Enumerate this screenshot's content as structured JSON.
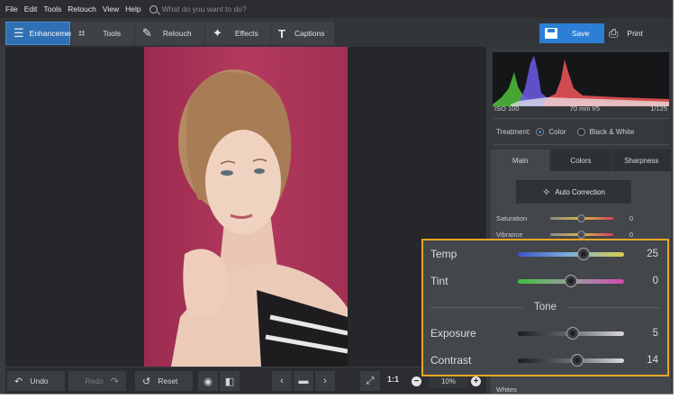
{
  "menu": {
    "items": [
      "File",
      "Edit",
      "Tools",
      "Retouch",
      "View",
      "Help"
    ],
    "search_placeholder": "What do you want to do?"
  },
  "toolbar": {
    "tabs": [
      {
        "label": "Enhancement",
        "icon": "sliders-icon",
        "active": true
      },
      {
        "label": "Tools",
        "icon": "crop-icon",
        "active": false
      },
      {
        "label": "Retouch",
        "icon": "brush-icon",
        "active": false
      },
      {
        "label": "Effects",
        "icon": "magic-wand-icon",
        "active": false
      },
      {
        "label": "Captions",
        "icon": "text-icon",
        "active": false
      }
    ],
    "save_label": "Save",
    "print_label": "Print"
  },
  "bottom": {
    "undo_label": "Undo",
    "redo_label": "Redo",
    "reset_label": "Reset",
    "zoom_ratio": "1:1",
    "zoom_value": "10%"
  },
  "panel": {
    "histogram": {
      "iso": "ISO 100",
      "lens": "70 mm f/5",
      "shutter": "1/125"
    },
    "treatment_label": "Treatment:",
    "treatment_options": [
      "Color",
      "Black & White"
    ],
    "treatment_selected": "Color",
    "subtabs": [
      "Main",
      "Colors",
      "Sharpness"
    ],
    "active_subtab": "Main",
    "auto_correction_label": "Auto Correction",
    "sliders": [
      {
        "label": "Saturation",
        "value": "0",
        "position": 0.5
      },
      {
        "label": "Vibrance",
        "value": "0",
        "position": 0.5
      }
    ],
    "whites_label": "Whites"
  },
  "callout": {
    "tone_label": "Tone",
    "sliders": [
      {
        "label": "Temp",
        "value": "25",
        "position": 0.62
      },
      {
        "label": "Tint",
        "value": "0",
        "position": 0.5
      },
      {
        "label": "Exposure",
        "value": "5",
        "position": 0.52
      },
      {
        "label": "Contrast",
        "value": "14",
        "position": 0.56
      }
    ]
  },
  "colors": {
    "accent": "#2b7fd4",
    "callout_border": "#e8a623",
    "backdrop": "#a83258"
  }
}
